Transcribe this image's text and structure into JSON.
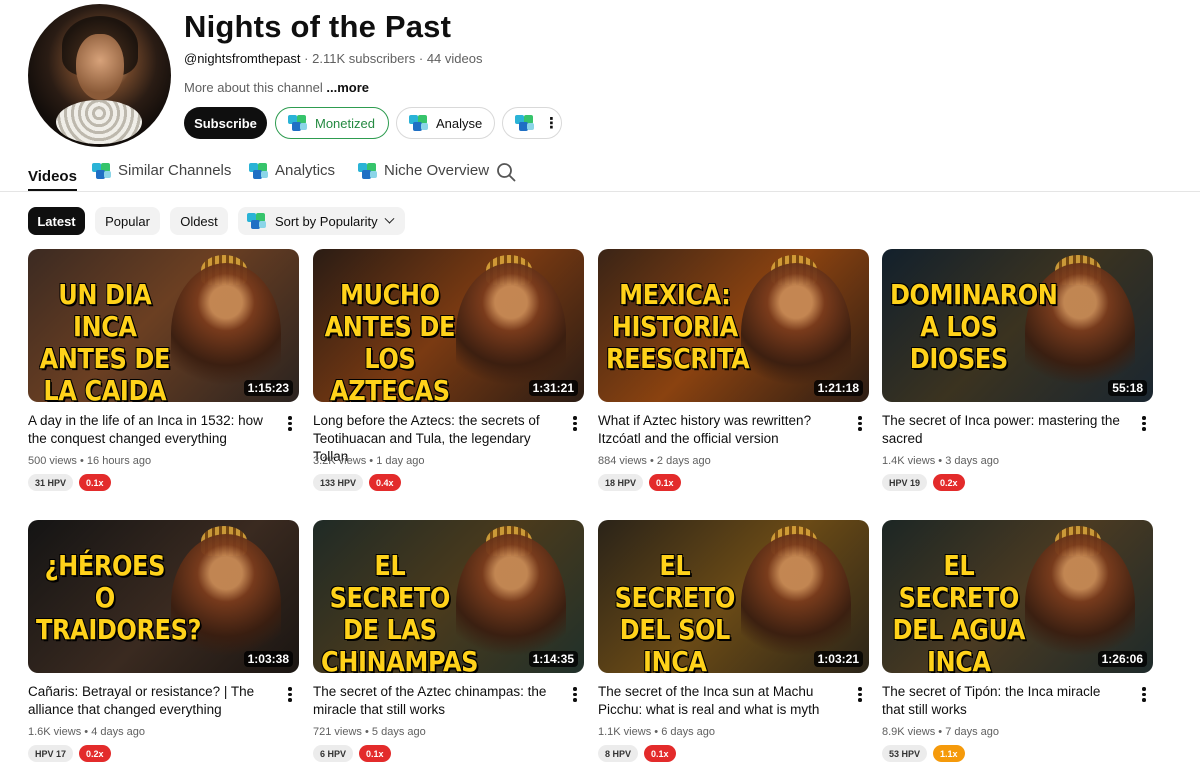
{
  "channel": {
    "name": "Nights of the Past",
    "handle": "@nightsfromthepast",
    "subscribers": "2.11K subscribers",
    "videos_count": "44 videos",
    "separator": "·",
    "about": "More about this channel",
    "more": "...more"
  },
  "actions": {
    "subscribe": "Subscribe",
    "monetized": "Monetized",
    "analyse": "Analyse"
  },
  "tabs": {
    "videos": "Videos",
    "similar": "Similar Channels",
    "analytics": "Analytics",
    "niche": "Niche Overview"
  },
  "filters": {
    "latest": "Latest",
    "popular": "Popular",
    "oldest": "Oldest",
    "sort": "Sort by Popularity"
  },
  "colors": {
    "red_badge": "#e32b2b",
    "orange_badge": "#f59a0b",
    "monetized_green": "#248a41"
  },
  "videos": [
    {
      "thumb_text": "Un dia Inca\nantes de\nla caida",
      "thumb_bg": "linear-gradient(135deg,#3b2a22,#6b3f22 45%,#2a2320)",
      "duration": "1:15:23",
      "title": "A day in the life of an Inca in 1532: how the conquest changed everything",
      "views": "500 views",
      "age": "16 hours ago",
      "hpv": "31 HPV",
      "ratio": "0.1x",
      "ratio_color": "#e32b2b"
    },
    {
      "thumb_text": "Mucho\nantes de\nlos Aztecas",
      "thumb_bg": "linear-gradient(135deg,#2a1c14,#7a3a12 50%,#2a1c14)",
      "duration": "1:31:21",
      "title": "Long before the Aztecs: the secrets of Teotihuacan and Tula, the legendary Tollan",
      "views": "3.2K views",
      "age": "1 day ago",
      "hpv": "133 HPV",
      "ratio": "0.4x",
      "ratio_color": "#e32b2b"
    },
    {
      "thumb_text": "Mexica:\nhistoria\nreescrita",
      "thumb_bg": "linear-gradient(135deg,#3a2416,#8a4210 50%,#2c1d14)",
      "duration": "1:21:18",
      "title": "What if Aztec history was rewritten? Itzcóatl and the official version",
      "views": "884 views",
      "age": "2 days ago",
      "hpv": "18 HPV",
      "ratio": "0.1x",
      "ratio_color": "#e32b2b"
    },
    {
      "thumb_text": "Dominaron\na los\ndioses",
      "thumb_bg": "linear-gradient(135deg,#12202c,#3b3320 50%,#1a2630)",
      "duration": "55:18",
      "title": "The secret of Inca power: mastering the sacred",
      "views": "1.4K views",
      "age": "3 days ago",
      "hpv": "HPV 19",
      "ratio": "0.2x",
      "ratio_color": "#e32b2b"
    },
    {
      "thumb_text": "¿Héroes o\ntraidores?",
      "thumb_bg": "linear-gradient(135deg,#141414,#3a2a20 55%,#1a1512)",
      "duration": "1:03:38",
      "title": "Cañaris: Betrayal or resistance? | The alliance that changed everything",
      "views": "1.6K views",
      "age": "4 days ago",
      "hpv": "HPV 17",
      "ratio": "0.2x",
      "ratio_color": "#e32b2b"
    },
    {
      "thumb_text": "El secreto\nde las\nchinampas\naztecas",
      "thumb_bg": "linear-gradient(135deg,#1f2a26,#4a3a1c 50%,#20302a)",
      "duration": "1:14:35",
      "title": "The secret of the Aztec chinampas: the miracle that still works",
      "views": "721 views",
      "age": "5 days ago",
      "hpv": "6 HPV",
      "ratio": "0.1x",
      "ratio_color": "#e32b2b"
    },
    {
      "thumb_text": "El secreto\ndel sol\nInca",
      "thumb_bg": "linear-gradient(135deg,#2a2318,#6a4a16 50%,#2a2418)",
      "duration": "1:03:21",
      "title": "The secret of the Inca sun at Machu Picchu: what is real and what is myth",
      "views": "1.1K views",
      "age": "6 days ago",
      "hpv": "8 HPV",
      "ratio": "0.1x",
      "ratio_color": "#e32b2b"
    },
    {
      "thumb_text": "El secreto\ndel agua\nInca",
      "thumb_bg": "linear-gradient(135deg,#1c2624,#4a3a22 50%,#1e2a2a)",
      "duration": "1:26:06",
      "title": "The secret of Tipón: the Inca miracle that still works",
      "views": "8.9K views",
      "age": "7 days ago",
      "hpv": "53 HPV",
      "ratio": "1.1x",
      "ratio_color": "#f59a0b"
    }
  ]
}
